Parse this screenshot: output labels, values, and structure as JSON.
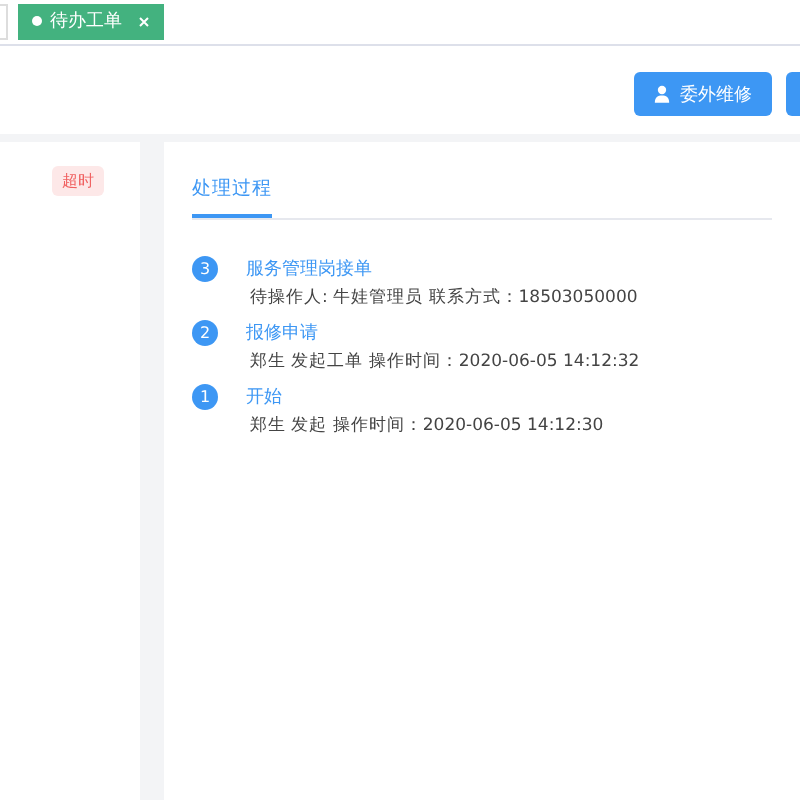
{
  "tabs": [
    {
      "label": "待办工单",
      "selected": true
    }
  ],
  "toolbar": {
    "buttons": [
      {
        "label": "委外维修"
      }
    ]
  },
  "left_panel": {
    "badge": "超时"
  },
  "process_panel": {
    "tabs": [
      {
        "label": "处理过程",
        "selected": true
      }
    ],
    "steps": [
      {
        "number": "3",
        "title": "服务管理岗接单",
        "detail": "待操作人: 牛娃管理员 联系方式：18503050000"
      },
      {
        "number": "2",
        "title": "报修申请",
        "detail": "郑生 发起工单 操作时间：2020-06-05 14:12:32"
      },
      {
        "number": "1",
        "title": "开始",
        "detail": "郑生 发起 操作时间：2020-06-05 14:12:30"
      }
    ]
  }
}
